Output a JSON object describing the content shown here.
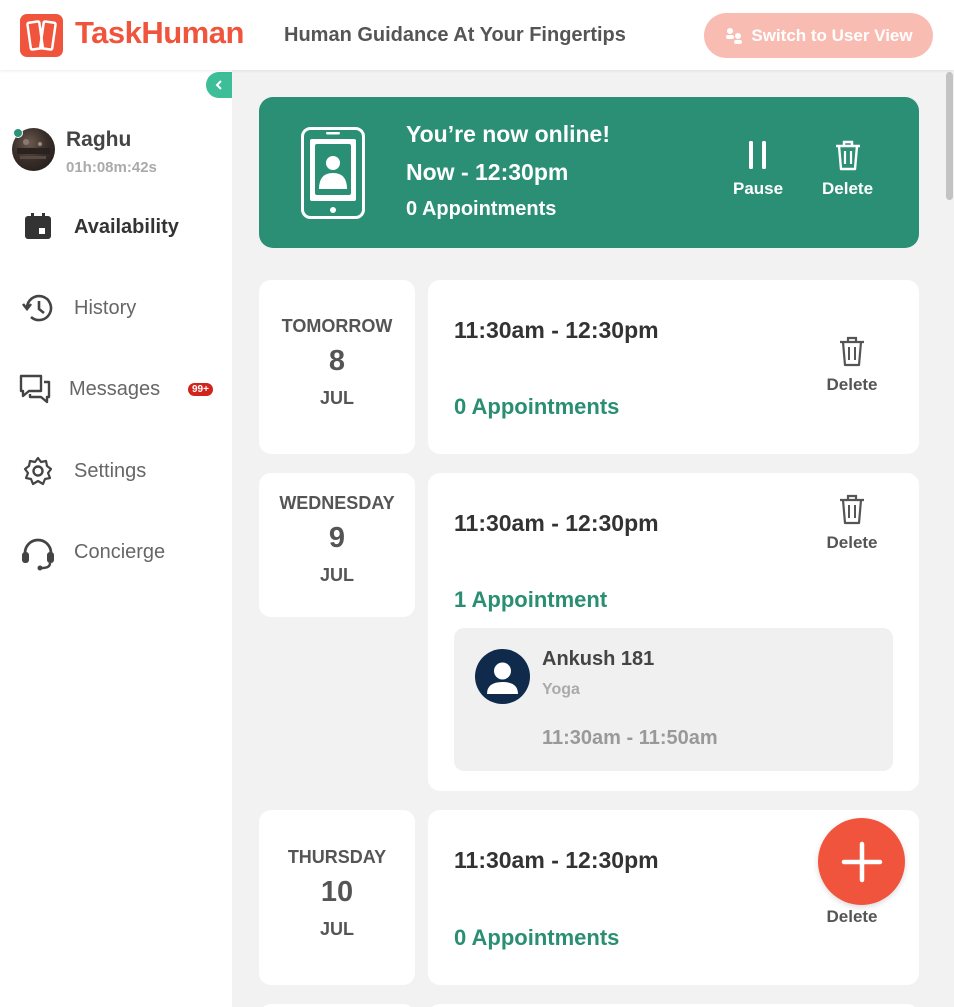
{
  "header": {
    "brand": "TaskHuman",
    "tagline": "Human Guidance At Your Fingertips",
    "switch_label": "Switch to User View"
  },
  "sidebar": {
    "user": {
      "name": "Raghu",
      "timer": "01h:08m:42s"
    },
    "items": [
      {
        "label": "Availability",
        "icon": "calendar-icon",
        "active": true
      },
      {
        "label": "History",
        "icon": "history-icon"
      },
      {
        "label": "Messages",
        "icon": "chat-icon",
        "badge": "99+"
      },
      {
        "label": "Settings",
        "icon": "gear-icon"
      },
      {
        "label": "Concierge",
        "icon": "headset-icon"
      }
    ]
  },
  "banner": {
    "status": "You’re now online!",
    "time_range": "Now - 12:30pm",
    "appointments": "0 Appointments",
    "pause_label": "Pause",
    "delete_label": "Delete"
  },
  "slots": [
    {
      "day": "TOMORROW",
      "date": "8",
      "month": "JUL",
      "time": "11:30am - 12:30pm",
      "appointments": "0 Appointments",
      "delete_label": "Delete"
    },
    {
      "day": "WEDNESDAY",
      "date": "9",
      "month": "JUL",
      "time": "11:30am - 12:30pm",
      "appointments": "1 Appointment",
      "delete_label": "Delete",
      "appointment": {
        "name": "Ankush 181",
        "category": "Yoga",
        "time": "11:30am - 11:50am"
      }
    },
    {
      "day": "THURSDAY",
      "date": "10",
      "month": "JUL",
      "time": "11:30am - 12:30pm",
      "appointments": "0 Appointments",
      "delete_label": "Delete"
    }
  ],
  "colors": {
    "brand": "#f0543c",
    "accent": "#2b8f75",
    "badge": "#d0241d"
  }
}
